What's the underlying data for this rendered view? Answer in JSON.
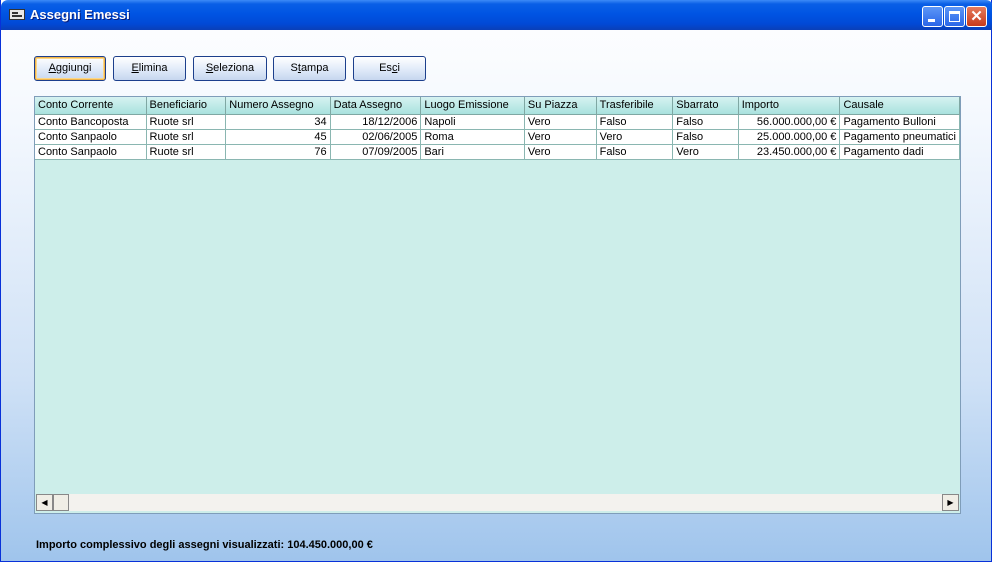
{
  "window": {
    "title": "Assegni Emessi"
  },
  "toolbar": {
    "add": {
      "mn": "A",
      "rest": "ggiungi"
    },
    "delete": {
      "mn": "E",
      "rest": "limina"
    },
    "select": {
      "mn": "S",
      "rest": "eleziona"
    },
    "print": {
      "pre": "S",
      "mn": "t",
      "rest": "ampa"
    },
    "exit": {
      "pre": "Es",
      "mn": "c",
      "rest": "i"
    }
  },
  "grid": {
    "columns": [
      "Conto Corrente",
      "Beneficiario",
      "Numero Assegno",
      "Data Assegno",
      "Luogo Emissione",
      "Su Piazza",
      "Trasferibile",
      "Sbarrato",
      "Importo",
      "Causale"
    ],
    "rows": [
      [
        "Conto Bancoposta",
        "Ruote srl",
        "34",
        "18/12/2006",
        "Napoli",
        "Vero",
        "Falso",
        "Falso",
        "56.000.000,00 €",
        "Pagamento Bulloni"
      ],
      [
        "Conto Sanpaolo",
        "Ruote srl",
        "45",
        "02/06/2005",
        "Roma",
        "Vero",
        "Vero",
        "Falso",
        "25.000.000,00 €",
        "Pagamento pneumatici"
      ],
      [
        "Conto Sanpaolo",
        "Ruote srl",
        "76",
        "07/09/2005",
        "Bari",
        "Vero",
        "Falso",
        "Vero",
        "23.450.000,00 €",
        "Pagamento dadi"
      ]
    ]
  },
  "footer": {
    "total_text": "Importo complessivo degli assegni visualizzati: 104.450.000,00 €"
  }
}
